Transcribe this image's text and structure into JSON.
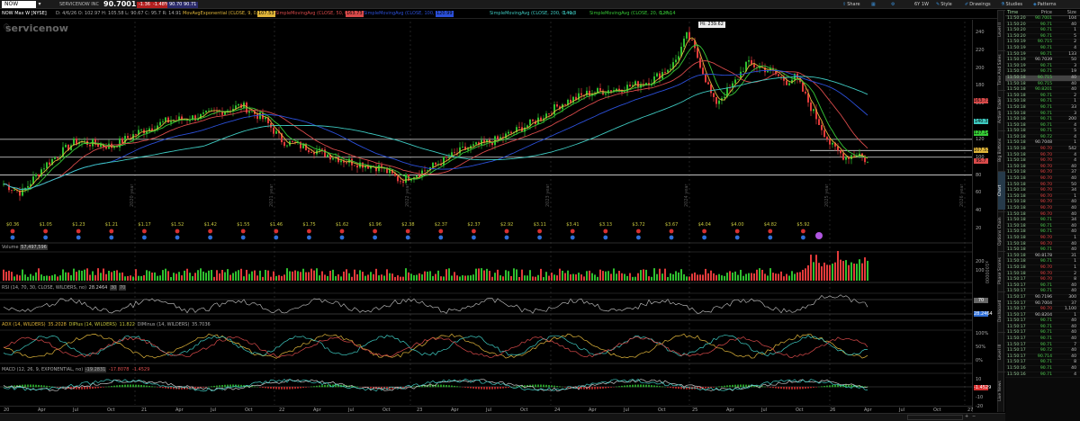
{
  "topbar": {
    "symbol": "NOW",
    "company": "SERVICENOW INC",
    "last": "90.7001",
    "change": "-1.36",
    "change_pct": "-1.48%",
    "bid": "90.70",
    "ask": "90.71",
    "tools": [
      "Share",
      "Flexible Grid",
      "Drawings",
      "Studies",
      "Patterns"
    ],
    "timeframe": "6Y 1W",
    "style": "Style"
  },
  "studybar": {
    "title": "NOW Max W [NYSE]",
    "ohlc": "D: 4/6/26   O: 102.97   H: 105.58   L: 90.67   C: 95.7   R: 14.91",
    "ema": "MovAvgExponential (CLOSE, 9, 0, no)",
    "ema_val": "107.53",
    "sma50": "SimpleMovingAvg (CLOSE, 50, 0, no)",
    "sma50_val": "163.73",
    "sma100": "SimpleMovingAvg (CLOSE, 100, 0, no)",
    "sma100_val": "120.99",
    "sma200": "SimpleMovingAvg (CLOSE, 200, 0, no)",
    "sma200_val": "140.3",
    "sma20": "SimpleMovingAvg (CLOSE, 20, 0, no)",
    "sma20_val": "127.14"
  },
  "watermark": "servicenow",
  "hi_label": "Hi: 239.62",
  "price_axis": [
    "240",
    "220",
    "200",
    "180",
    "160",
    "140",
    "120",
    "100",
    "80",
    "60",
    "40",
    "20"
  ],
  "price_badges": [
    {
      "text": "163.73",
      "color": "#d84a4a"
    },
    {
      "text": "140.3",
      "color": "#3ec9c0"
    },
    {
      "text": "127.14",
      "color": "#36c936"
    },
    {
      "text": "107.53",
      "color": "#e0b53a"
    },
    {
      "text": "95.7",
      "color": "#d84a4a"
    }
  ],
  "dividends": [
    "$0.36",
    "$1.05",
    "$1.23",
    "$1.21",
    "$1.17",
    "$1.52",
    "$1.42",
    "$1.55",
    "$1.46",
    "$1.75",
    "$1.62",
    "$1.96",
    "$2.38",
    "$2.37",
    "$2.37",
    "$2.92",
    "$3.11",
    "$3.41",
    "$3.13",
    "$3.72",
    "$3.67",
    "$4.04",
    "$4.00",
    "$4.82",
    "$5.92"
  ],
  "volume": {
    "label": "Volume",
    "value": "57,497,596",
    "axis": [
      "200",
      "100"
    ],
    "units": "x1000000"
  },
  "rsi": {
    "label": "RSI (14, 70, 30, CLOSE, WILDERS, no)",
    "value": "28.2464",
    "ob": "30",
    "os": "70",
    "badges": [
      "70",
      "28.2464"
    ]
  },
  "adx": {
    "label": "ADX (14, WILDERS)",
    "value": "35.2028",
    "dip_label": "DIPlus (14, WILDERS)",
    "dip": "11.822",
    "dim_label": "DIMinus (14, WILDERS)",
    "dim": "35.7036",
    "axis": [
      "100%",
      "50%",
      "0%"
    ]
  },
  "macd": {
    "label": "MACD (12, 26, 9, EXPONENTIAL, no)",
    "value": "-19.2831",
    "avg": "-17.8078",
    "diff": "-1.4529",
    "axis": [
      "10",
      "0",
      "-10",
      "-20"
    ],
    "badge": "-1.4529"
  },
  "x_axis": [
    "20",
    "Apr",
    "Jul",
    "Oct",
    "21",
    "Apr",
    "Jul",
    "Oct",
    "22",
    "Apr",
    "Jul",
    "Oct",
    "23",
    "Apr",
    "Jul",
    "Oct",
    "24",
    "Apr",
    "Jul",
    "Oct",
    "25",
    "Apr",
    "Jul",
    "Oct",
    "26",
    "Apr",
    "Jul",
    "Oct",
    "27"
  ],
  "year_tags": [
    "2020 year",
    "2021 year",
    "2022 year",
    "2023 year",
    "2024 year",
    "2025 year",
    "2026 year"
  ],
  "side_tabs": [
    "Level II",
    "Time And Sales",
    "Active Trader",
    "Big Buttons",
    "Chart",
    "Options Chain",
    "Phase Scores",
    "Dashboard",
    "Level III",
    "Live News"
  ],
  "time_and_sales": {
    "headers": [
      "Time",
      "Price",
      "Size"
    ],
    "rows": [
      [
        "11:50:20",
        "90.7001",
        "104",
        "up"
      ],
      [
        "11:50:20",
        "90.71",
        "40",
        "up"
      ],
      [
        "11:50:20",
        "90.71",
        "1",
        "up"
      ],
      [
        "11:50:20",
        "90.71",
        "5",
        "up"
      ],
      [
        "11:50:19",
        "90.715",
        "2",
        "up"
      ],
      [
        "11:50:19",
        "90.71",
        "4",
        "up"
      ],
      [
        "11:50:19",
        "90.71",
        "133",
        "up"
      ],
      [
        "11:50:19",
        "90.7039",
        "50",
        "mid"
      ],
      [
        "11:50:19",
        "90.71",
        "3",
        "up"
      ],
      [
        "11:50:19",
        "90.71",
        "19",
        "up"
      ],
      [
        "11:50:18",
        "90.715",
        "40",
        "up"
      ],
      [
        "11:50:18",
        "90.715",
        "40",
        "up"
      ],
      [
        "11:50:18",
        "90.8201",
        "40",
        "up"
      ],
      [
        "11:50:18",
        "90.71",
        "2",
        "up"
      ],
      [
        "11:50:18",
        "90.71",
        "1",
        "up"
      ],
      [
        "11:50:18",
        "90.71",
        "33",
        "up"
      ],
      [
        "11:50:18",
        "90.71",
        "3",
        "up"
      ],
      [
        "11:50:18",
        "90.71",
        "200",
        "up"
      ],
      [
        "11:50:18",
        "90.71",
        "4",
        "up"
      ],
      [
        "11:50:18",
        "90.71",
        "5",
        "up"
      ],
      [
        "11:50:18",
        "90.72",
        "4",
        "up"
      ],
      [
        "11:50:18",
        "90.7048",
        "1",
        "mid"
      ],
      [
        "11:50:18",
        "90.70",
        "542",
        "dn"
      ],
      [
        "11:50:18",
        "90.70",
        "4",
        "dn"
      ],
      [
        "11:50:18",
        "90.70",
        "4",
        "dn"
      ],
      [
        "11:50:18",
        "90.70",
        "40",
        "dn"
      ],
      [
        "11:50:18",
        "90.70",
        "37",
        "dn"
      ],
      [
        "11:50:18",
        "90.70",
        "40",
        "dn"
      ],
      [
        "11:50:18",
        "90.70",
        "50",
        "dn"
      ],
      [
        "11:50:18",
        "90.70",
        "34",
        "dn"
      ],
      [
        "11:50:18",
        "90.70",
        "1",
        "dn"
      ],
      [
        "11:50:18",
        "90.70",
        "40",
        "dn"
      ],
      [
        "11:50:18",
        "90.70",
        "40",
        "dn"
      ],
      [
        "11:50:18",
        "90.70",
        "40",
        "dn"
      ],
      [
        "11:50:18",
        "90.71",
        "34",
        "up"
      ],
      [
        "11:50:18",
        "90.71",
        "40",
        "up"
      ],
      [
        "11:50:18",
        "90.71",
        "40",
        "up"
      ],
      [
        "11:50:18",
        "90.70",
        "1",
        "dn"
      ],
      [
        "11:50:18",
        "90.70",
        "40",
        "dn"
      ],
      [
        "11:50:18",
        "90.71",
        "40",
        "up"
      ],
      [
        "11:50:18",
        "90.8178",
        "31",
        "mid"
      ],
      [
        "11:50:18",
        "90.71",
        "1",
        "up"
      ],
      [
        "11:50:18",
        "90.70",
        "1",
        "dn"
      ],
      [
        "11:50:18",
        "90.70",
        "2",
        "dn"
      ],
      [
        "11:50:17",
        "90.70",
        "8",
        "dn"
      ],
      [
        "11:50:17",
        "90.71",
        "40",
        "up"
      ],
      [
        "11:50:17",
        "90.71",
        "40",
        "up"
      ],
      [
        "11:50:17",
        "90.7196",
        "300",
        "mid"
      ],
      [
        "11:50:17",
        "90.7004",
        "37",
        "mid"
      ],
      [
        "11:50:17",
        "90.70",
        "1,100",
        "dn"
      ],
      [
        "11:50:17",
        "90.8204",
        "1",
        "mid"
      ],
      [
        "11:50:17",
        "90.71",
        "40",
        "up"
      ],
      [
        "11:50:17",
        "90.71",
        "40",
        "up"
      ],
      [
        "11:50:17",
        "90.71",
        "40",
        "up"
      ],
      [
        "11:50:17",
        "90.71",
        "40",
        "up"
      ],
      [
        "11:50:17",
        "90.71",
        "7",
        "up"
      ],
      [
        "11:50:17",
        "90.72",
        "40",
        "up"
      ],
      [
        "11:50:17",
        "90.714",
        "40",
        "up"
      ],
      [
        "11:50:17",
        "90.71",
        "8",
        "up"
      ],
      [
        "11:50:16",
        "90.71",
        "40",
        "up"
      ],
      [
        "11:50:16",
        "90.71",
        "4",
        "up"
      ]
    ]
  },
  "colors": {
    "up": "#2fbf2f",
    "down": "#e23b3b",
    "ema": "#e0b53a",
    "sma50": "#d84a4a",
    "sma200": "#3ec9c0",
    "sma20": "#36c936",
    "sma100": "#2b4fd8"
  }
}
